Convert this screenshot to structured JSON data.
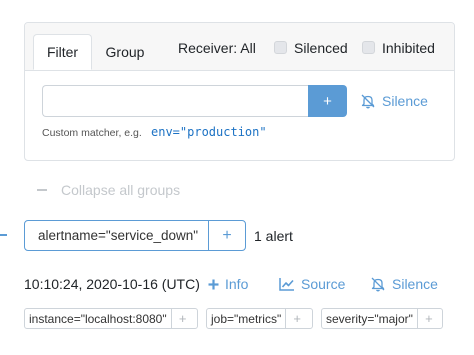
{
  "filter_panel": {
    "tabs": [
      {
        "label": "Filter",
        "active": true
      },
      {
        "label": "Group",
        "active": false
      }
    ],
    "receiver_label": "Receiver: All",
    "silenced": {
      "label": "Silenced",
      "checked": false
    },
    "inhibited": {
      "label": "Inhibited",
      "checked": false
    },
    "input_value": "",
    "add_button_label": "+",
    "silence_label": "Silence",
    "hint_text": "Custom matcher, e.g.",
    "hint_example": "env=\"production\""
  },
  "collapse_label": "Collapse all groups",
  "group": {
    "label": "alertname=\"service_down\"",
    "add_label": "+",
    "count_text": "1 alert"
  },
  "alert": {
    "timestamp": "10:10:24, 2020-10-16 (UTC)",
    "info_label": "Info",
    "source_label": "Source",
    "silence_label": "Silence",
    "labels": [
      {
        "text": "instance=\"localhost:8080\"",
        "add": "+"
      },
      {
        "text": "job=\"metrics\"",
        "add": "+"
      },
      {
        "text": "severity=\"major\"",
        "add": "+"
      }
    ]
  },
  "colors": {
    "accent": "#5b9bd5",
    "border": "#dee2e6",
    "muted": "#c4c8cc"
  },
  "icons": [
    "bell-slash-icon",
    "plus-icon",
    "chart-line-icon",
    "minus-icon"
  ]
}
